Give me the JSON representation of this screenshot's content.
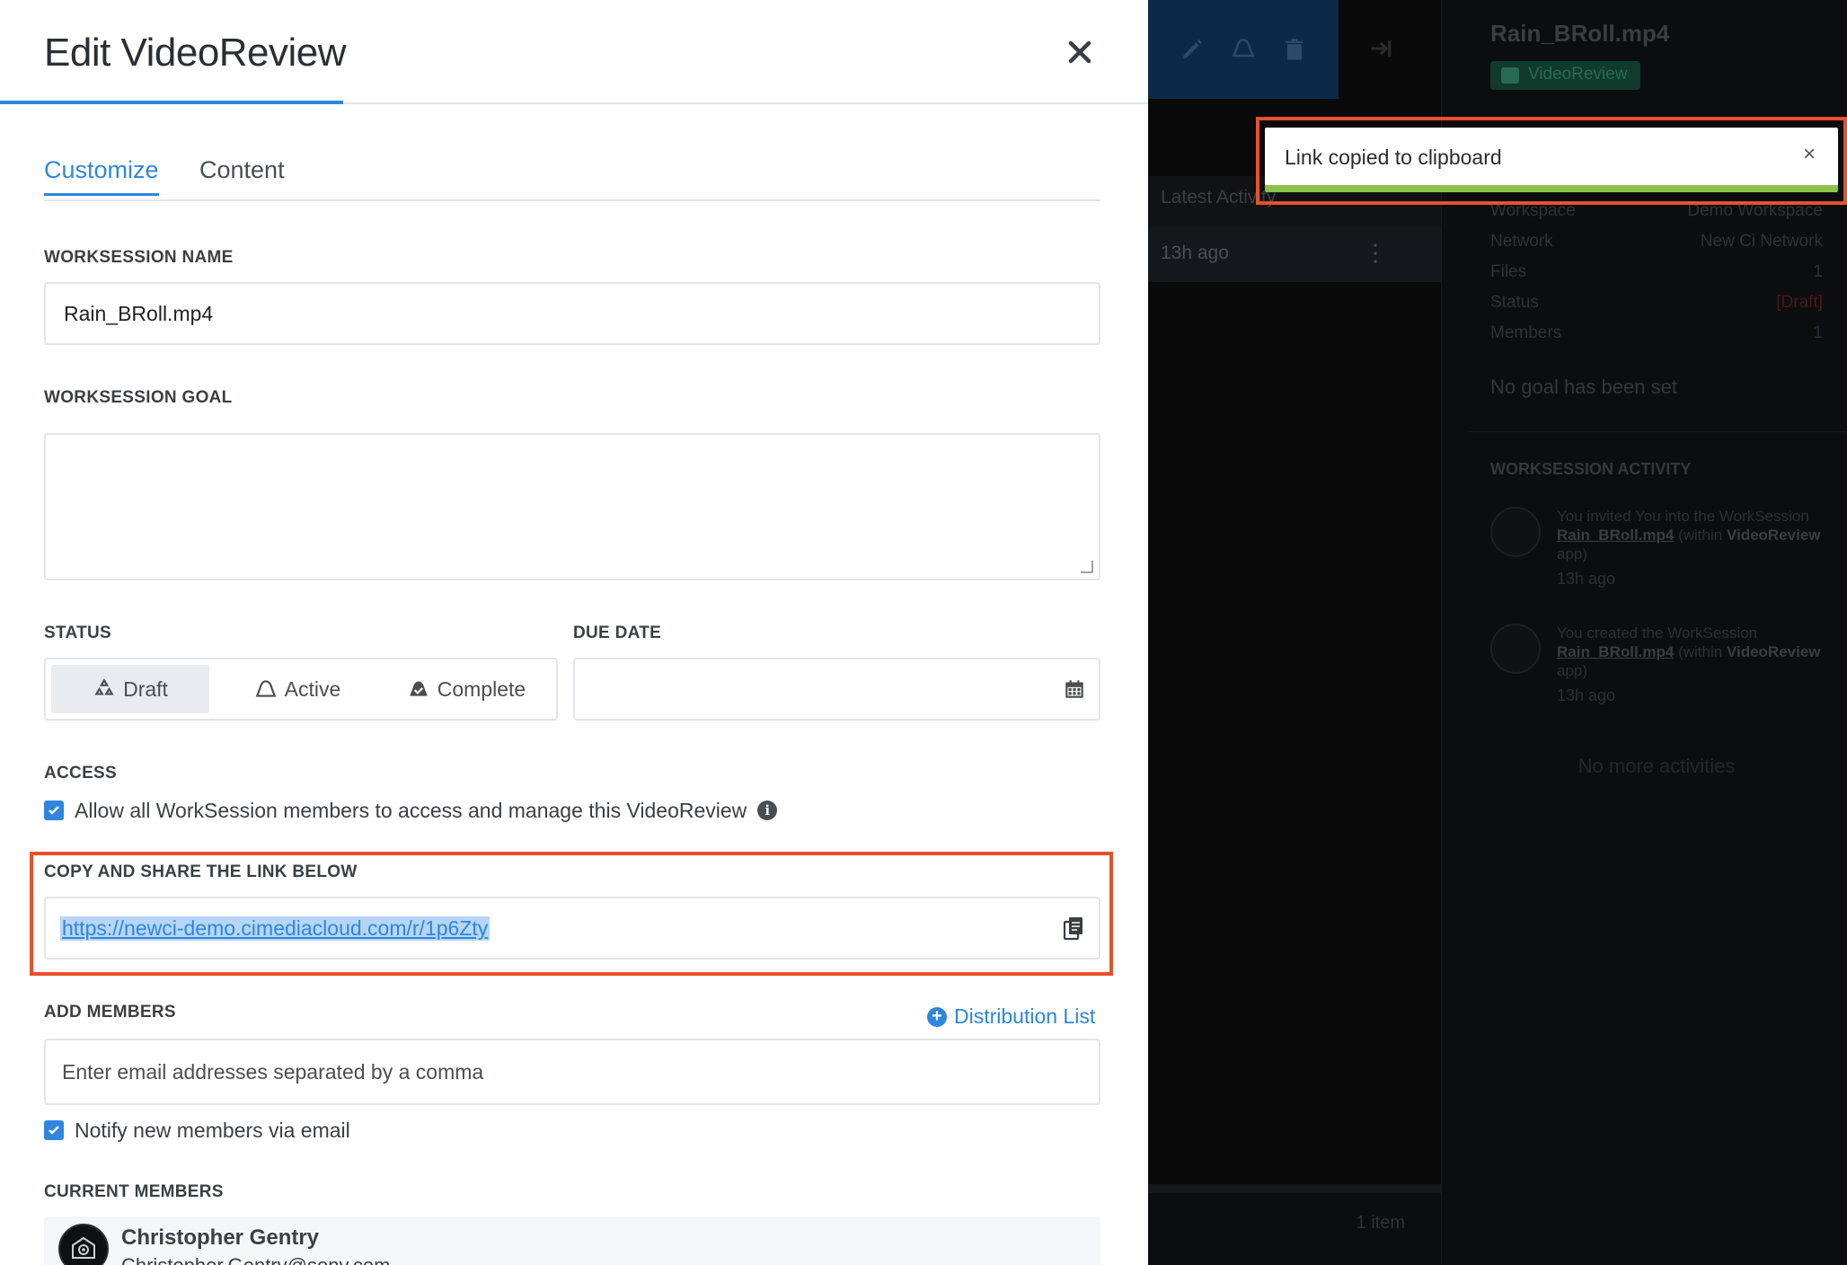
{
  "colors": {
    "accent": "#2e86de",
    "highlight_frame": "#e8502d",
    "toast_progress": "#8bc34a"
  },
  "modal": {
    "title": "Edit VideoReview",
    "close_icon": "close-icon",
    "tabs": [
      {
        "label": "Customize",
        "active": true
      },
      {
        "label": "Content",
        "active": false
      }
    ],
    "name": {
      "label": "WORKSESSION NAME",
      "value": "Rain_BRoll.mp4"
    },
    "goal": {
      "label": "WORKSESSION GOAL",
      "value": ""
    },
    "status": {
      "label": "STATUS",
      "options": [
        {
          "label": "Draft",
          "icon": "recycle-icon",
          "selected": true
        },
        {
          "label": "Active",
          "icon": "bell-icon",
          "selected": false
        },
        {
          "label": "Complete",
          "icon": "check-envelope-icon",
          "selected": false
        }
      ]
    },
    "due_date": {
      "label": "DUE DATE",
      "value": "",
      "icon": "calendar-icon"
    },
    "access": {
      "label": "ACCESS",
      "checkbox_label": "Allow all WorkSession members to access and manage this VideoReview",
      "checked": true,
      "info_icon": "info-icon"
    },
    "share": {
      "label": "COPY AND SHARE THE LINK BELOW",
      "link": "https://newci-demo.cimediacloud.com/r/1p6Zty",
      "copy_icon": "copy-icon"
    },
    "add_members": {
      "label": "ADD MEMBERS",
      "distribution_list": "Distribution List",
      "placeholder": "Enter email addresses separated by a comma",
      "notify_label": "Notify new members via email",
      "notify_checked": true
    },
    "current_members": {
      "label": "CURRENT MEMBERS",
      "items": [
        {
          "name": "Christopher Gentry",
          "email": "Christopher.Gentry@sony.com"
        }
      ]
    }
  },
  "toast": {
    "message": "Link copied to clipboard",
    "close": "×"
  },
  "background": {
    "toolbar_icons": [
      "pencil-icon",
      "bell-icon",
      "trash-icon",
      "exit-icon"
    ],
    "list_header": "Latest Activity",
    "list_row_time": "13h ago",
    "list_footer": "1 item",
    "panel": {
      "title": "Rain_BRoll.mp4",
      "badge": "VideoReview",
      "meta": [
        {
          "key": "Workspace",
          "value": "Demo Workspace"
        },
        {
          "key": "Network",
          "value": "New Ci Network"
        },
        {
          "key": "Files",
          "value": "1"
        },
        {
          "key": "Status",
          "value": "[Draft]"
        },
        {
          "key": "Members",
          "value": "1"
        }
      ],
      "no_goal": "No goal has been set",
      "activity_header": "WORKSESSION ACTIVITY",
      "activities": [
        {
          "text_pre": "You invited You into the WorkSession ",
          "link": "Rain_BRoll.mp4",
          "text_mid": " (within ",
          "app": "VideoReview",
          "text_post": " app)",
          "time": "13h ago"
        },
        {
          "text_pre": "You created the WorkSession ",
          "link": "Rain_BRoll.mp4",
          "text_mid": " (within ",
          "app": "VideoReview",
          "text_post": " app)",
          "time": "13h ago"
        }
      ],
      "no_more": "No more activities"
    }
  }
}
